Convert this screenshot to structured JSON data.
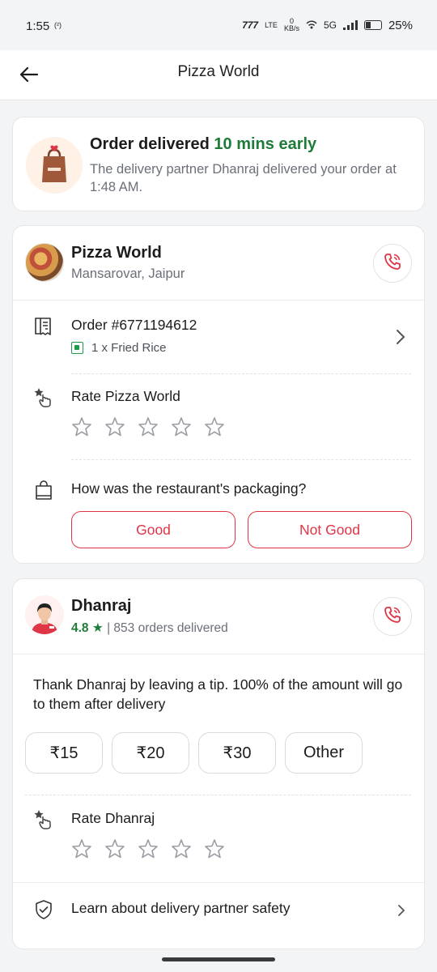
{
  "status_bar": {
    "time": "1:55",
    "time_icon_label": "(²)",
    "network_lte": "LTE",
    "net_speed_value": "0",
    "net_speed_unit": "KB/s",
    "network_type": "5G",
    "battery_percent": "25%",
    "battery_level": 0.25
  },
  "header": {
    "title": "Pizza World"
  },
  "delivery_status": {
    "title_prefix": "Order delivered",
    "title_highlight": "10 mins early",
    "subtitle": "The delivery partner Dhanraj delivered your order at 1:48 AM."
  },
  "restaurant": {
    "name": "Pizza World",
    "location": "Mansarovar, Jaipur",
    "order_number": "Order #6771194612",
    "order_item": "1 x Fried Rice",
    "rate_label": "Rate Pizza World",
    "rating_stars_total": 5,
    "rating_stars_filled": 0,
    "packaging_question": "How was the restaurant's packaging?",
    "packaging_good": "Good",
    "packaging_not_good": "Not Good"
  },
  "delivery_partner": {
    "name": "Dhanraj",
    "rating": "4.8 ★",
    "separator": "|",
    "orders_delivered": "853 orders delivered",
    "tip_text": "Thank Dhanraj by leaving a tip. 100% of the amount will go to them after delivery",
    "tip_options": [
      "₹15",
      "₹20",
      "₹30",
      "Other"
    ],
    "rate_label": "Rate Dhanraj",
    "rating_stars_total": 5,
    "rating_stars_filled": 0,
    "safety_link": "Learn about delivery partner safety"
  },
  "colors": {
    "accent_red": "#e03546",
    "success_green": "#1e7c3a",
    "muted_text": "#6b6f78"
  }
}
